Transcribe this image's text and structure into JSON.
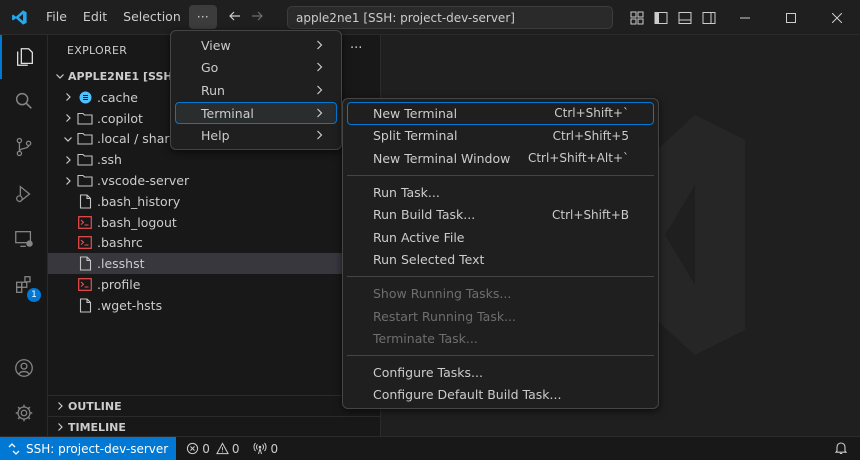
{
  "titlebar": {
    "menus": [
      "File",
      "Edit",
      "Selection",
      "···"
    ],
    "command_center": "apple2ne1 [SSH: project-dev-server]"
  },
  "sidebar": {
    "header": "EXPLORER",
    "more": "···",
    "root": "APPLE2NE1 [SSH: PR",
    "items": [
      {
        "label": ".cache",
        "type": "folder",
        "expanded": false
      },
      {
        "label": ".copilot",
        "type": "folder",
        "expanded": false
      },
      {
        "label": ".local / share /",
        "type": "folder",
        "expanded": true
      },
      {
        "label": ".ssh",
        "type": "folder",
        "expanded": false
      },
      {
        "label": ".vscode-server",
        "type": "folder",
        "expanded": false
      },
      {
        "label": ".bash_history",
        "type": "file"
      },
      {
        "label": ".bash_logout",
        "type": "terminal-file"
      },
      {
        "label": ".bashrc",
        "type": "terminal-file"
      },
      {
        "label": ".lesshst",
        "type": "file",
        "selected": true
      },
      {
        "label": ".profile",
        "type": "terminal-file"
      },
      {
        "label": ".wget-hsts",
        "type": "file"
      }
    ],
    "sections": [
      "OUTLINE",
      "TIMELINE"
    ]
  },
  "activity": {
    "extensions_badge": "1"
  },
  "menu_main": {
    "items": [
      {
        "label": "View"
      },
      {
        "label": "Go"
      },
      {
        "label": "Run"
      },
      {
        "label": "Terminal",
        "highlighted": true
      },
      {
        "label": "Help"
      }
    ]
  },
  "menu_terminal": {
    "groups": [
      [
        {
          "label": "New Terminal",
          "shortcut": "Ctrl+Shift+`",
          "highlighted": true
        },
        {
          "label": "Split Terminal",
          "shortcut": "Ctrl+Shift+5"
        },
        {
          "label": "New Terminal Window",
          "shortcut": "Ctrl+Shift+Alt+`"
        }
      ],
      [
        {
          "label": "Run Task...",
          "shortcut": ""
        },
        {
          "label": "Run Build Task...",
          "shortcut": "Ctrl+Shift+B"
        },
        {
          "label": "Run Active File",
          "shortcut": ""
        },
        {
          "label": "Run Selected Text",
          "shortcut": ""
        }
      ],
      [
        {
          "label": "Show Running Tasks...",
          "shortcut": "",
          "disabled": true
        },
        {
          "label": "Restart Running Task...",
          "shortcut": "",
          "disabled": true
        },
        {
          "label": "Terminate Task...",
          "shortcut": "",
          "disabled": true
        }
      ],
      [
        {
          "label": "Configure Tasks...",
          "shortcut": ""
        },
        {
          "label": "Configure Default Build Task...",
          "shortcut": ""
        }
      ]
    ]
  },
  "statusbar": {
    "remote": "SSH: project-dev-server",
    "errors": "0",
    "warnings": "0",
    "ports": "0"
  },
  "colors": {
    "accent": "#0078d4",
    "terminal_file": "#f14c4c",
    "cache_folder": "#4fc1ff"
  }
}
